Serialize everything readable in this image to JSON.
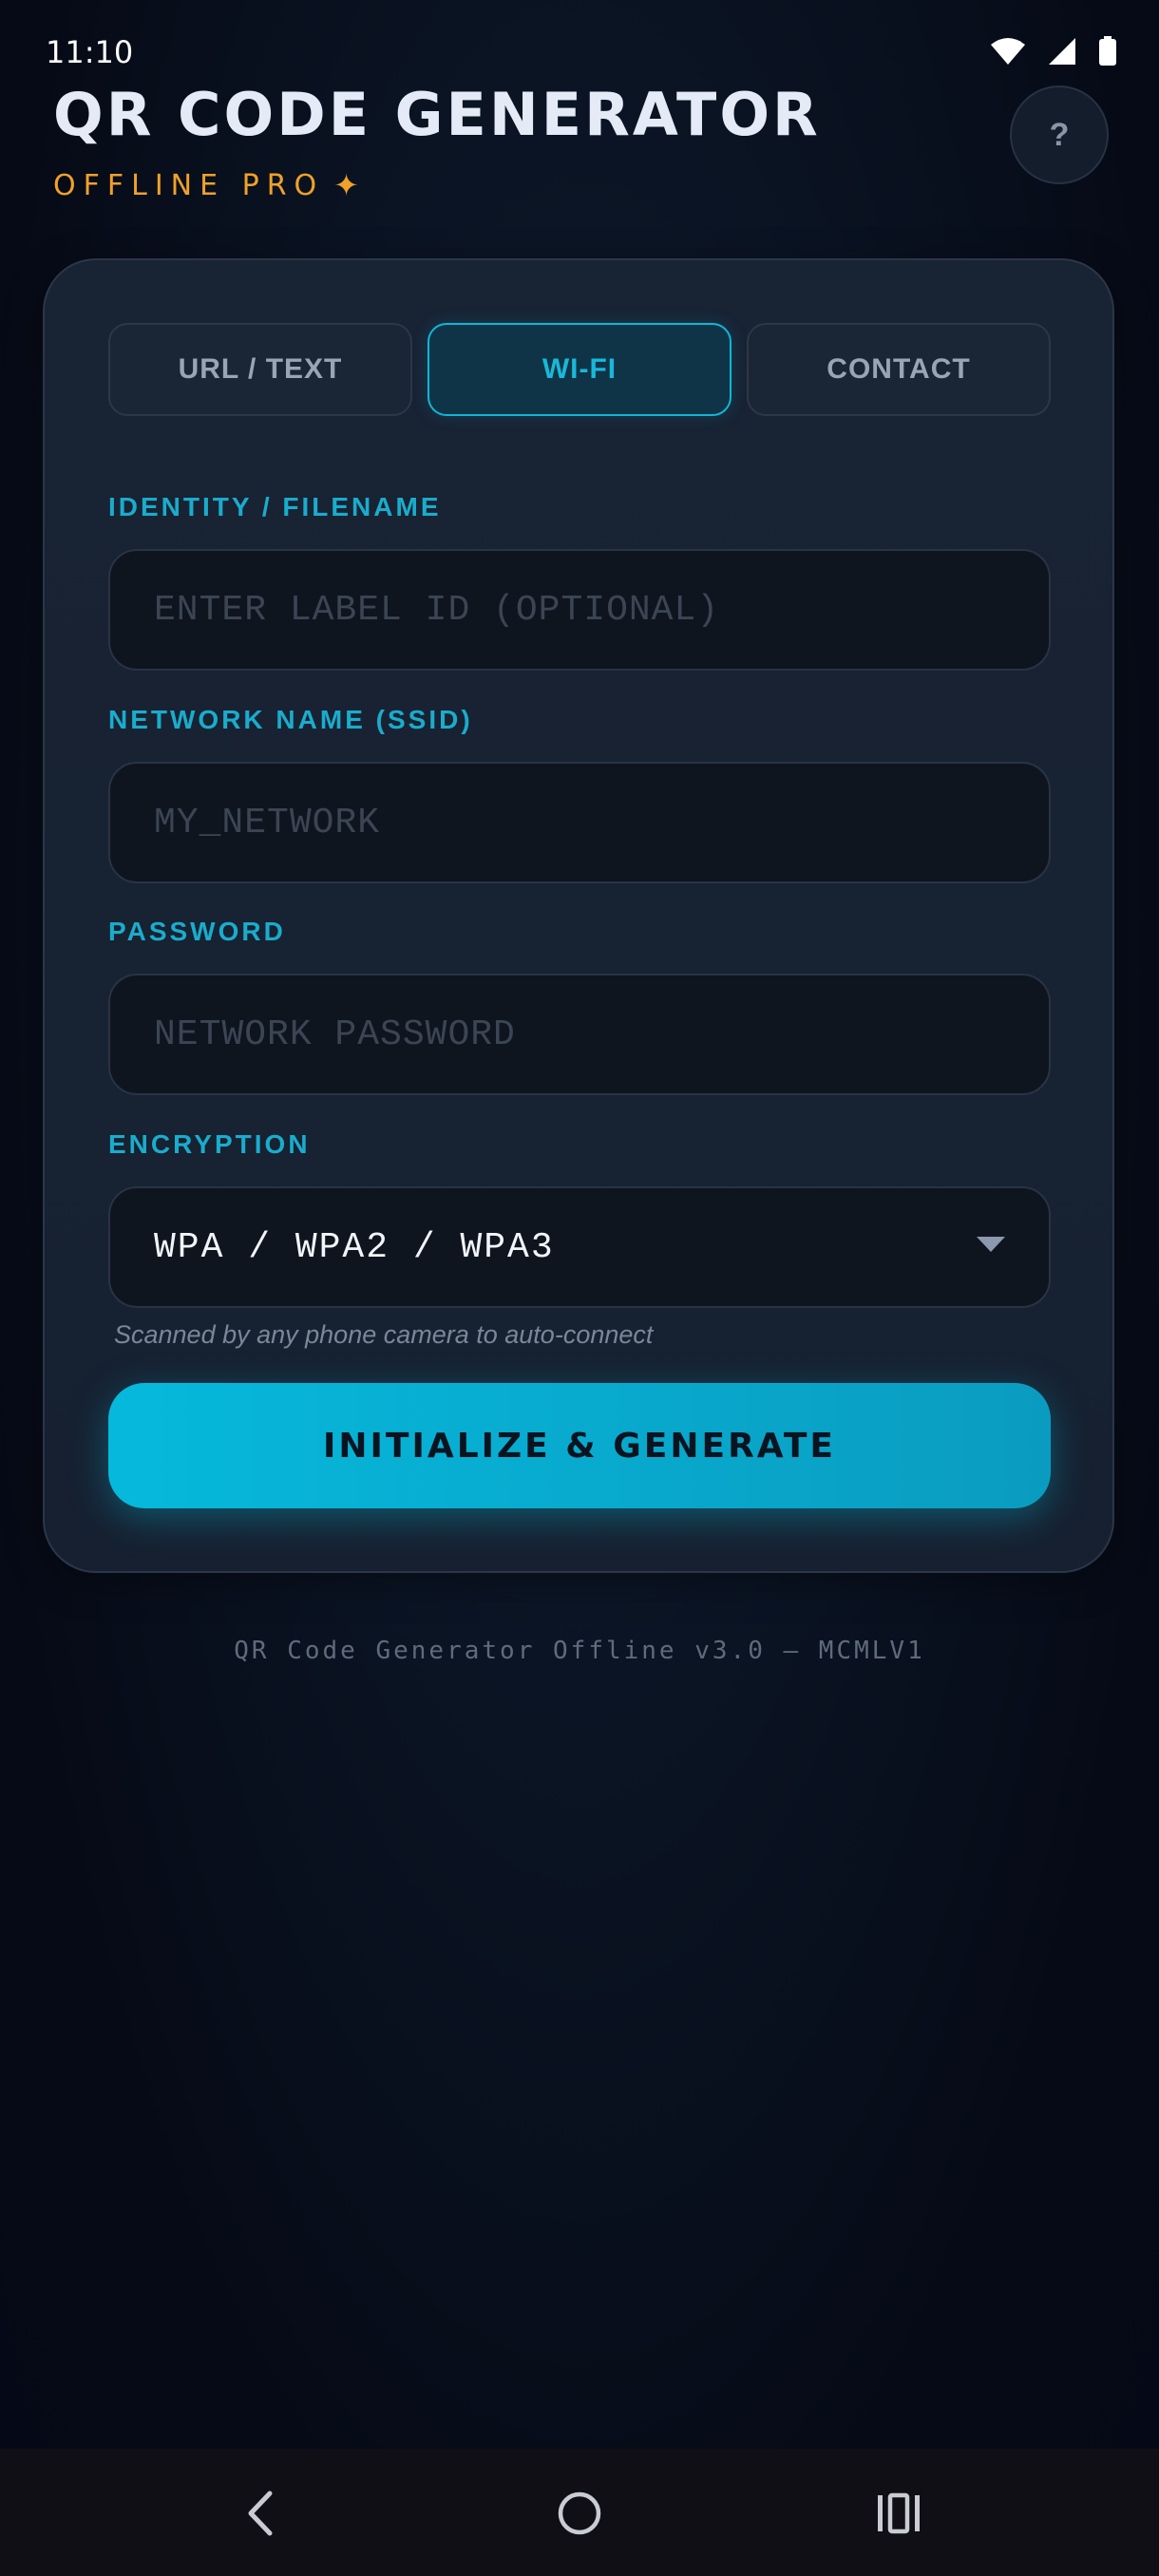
{
  "status_bar": {
    "time": "11:10"
  },
  "header": {
    "title": "QR CODE GENERATOR",
    "subtitle": "OFFLINE PRO",
    "subtitle_icon": "sparkle-icon",
    "help_label": "?"
  },
  "tabs": [
    {
      "label": "URL / TEXT",
      "active": false
    },
    {
      "label": "WI-FI",
      "active": true
    },
    {
      "label": "CONTACT",
      "active": false
    }
  ],
  "form": {
    "identity": {
      "label": "IDENTITY / FILENAME",
      "value": "",
      "placeholder": "ENTER LABEL ID (OPTIONAL)"
    },
    "ssid": {
      "label": "NETWORK NAME (SSID)",
      "value": "",
      "placeholder": "MY_NETWORK"
    },
    "password": {
      "label": "PASSWORD",
      "value": "",
      "placeholder": "NETWORK PASSWORD"
    },
    "encryption": {
      "label": "ENCRYPTION",
      "selected": "WPA / WPA2 / WPA3"
    },
    "helper": "Scanned by any phone camera to auto-connect",
    "generate_label": "INITIALIZE & GENERATE"
  },
  "footer": "QR Code Generator Offline v3.0 — MCMLV1",
  "colors": {
    "accent": "#11b6d6",
    "subtitle": "#f0a12a",
    "background": "#060a16",
    "card": "#172232"
  }
}
